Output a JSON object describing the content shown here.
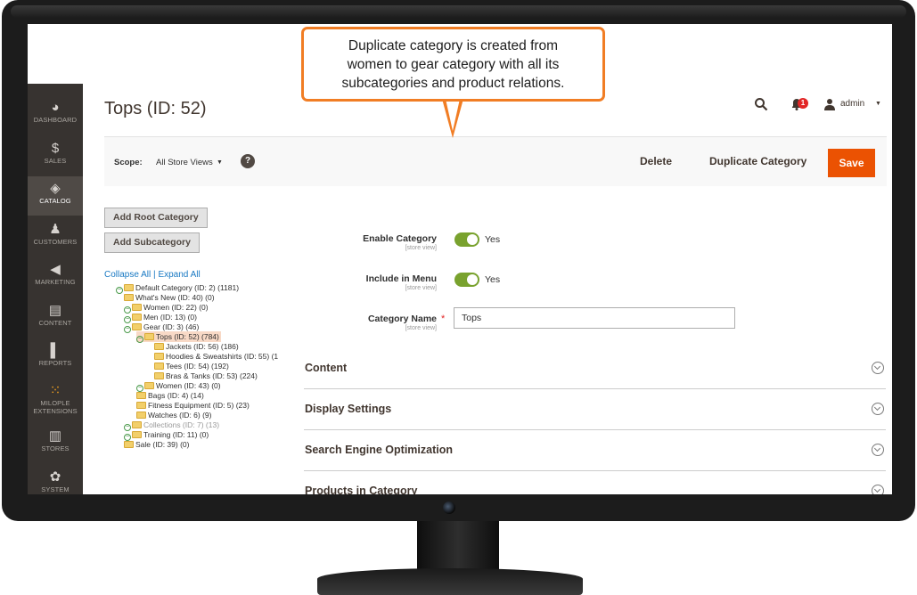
{
  "callout": {
    "lines": [
      "Duplicate category is created from",
      "women to gear category with all its",
      "subcategories and product relations."
    ]
  },
  "sidebar": {
    "items": [
      {
        "label": "DASHBOARD",
        "icon": "dashboard-icon",
        "glyph": "◕"
      },
      {
        "label": "SALES",
        "icon": "dollar-icon",
        "glyph": "$"
      },
      {
        "label": "CATALOG",
        "icon": "cube-icon",
        "glyph": "◈"
      },
      {
        "label": "CUSTOMERS",
        "icon": "person-icon",
        "glyph": "♟"
      },
      {
        "label": "MARKETING",
        "icon": "megaphone-icon",
        "glyph": "◀"
      },
      {
        "label": "CONTENT",
        "icon": "layout-icon",
        "glyph": "▤"
      },
      {
        "label": "REPORTS",
        "icon": "bar-chart-icon",
        "glyph": "▌"
      },
      {
        "label": "MILOPLE EXTENSIONS",
        "label_line1": "MILOPLE",
        "label_line2": "EXTENSIONS",
        "icon": "grid-icon",
        "glyph": "⁙"
      },
      {
        "label": "STORES",
        "icon": "store-icon",
        "glyph": "▥"
      },
      {
        "label": "SYSTEM",
        "icon": "gear-icon",
        "glyph": "✿"
      }
    ],
    "active": "CATALOG"
  },
  "header": {
    "title": "Tops (ID: 52)",
    "notification_count": "1",
    "user": "admin"
  },
  "toolbar": {
    "scope_label": "Scope:",
    "scope_value": "All Store Views",
    "help": "?",
    "delete_label": "Delete",
    "duplicate_label": "Duplicate Category",
    "save_label": "Save"
  },
  "left_panel": {
    "add_root_label": "Add Root Category",
    "add_sub_label": "Add Subcategory",
    "collapse_all": "Collapse All",
    "separator": "|",
    "expand_all": "Expand All"
  },
  "tree": [
    {
      "label": "Default Category (ID: 2) (1181)",
      "depth": 1,
      "expander": true
    },
    {
      "label": "What's New (ID: 40) (0)",
      "depth": 2,
      "expander": false
    },
    {
      "label": "Women (ID: 22) (0)",
      "depth": 2,
      "expander": true
    },
    {
      "label": "Men (ID: 13) (0)",
      "depth": 2,
      "expander": true
    },
    {
      "label": "Gear (ID: 3) (46)",
      "depth": 2,
      "expander": true
    },
    {
      "label": "Tops (ID: 52) (784)",
      "depth": 3,
      "expander": true,
      "selected": true
    },
    {
      "label": "Jackets (ID: 56) (186)",
      "depth": 4,
      "expander": false
    },
    {
      "label": "Hoodies & Sweatshirts (ID: 55) (1",
      "depth": 4,
      "expander": false
    },
    {
      "label": "Tees (ID: 54) (192)",
      "depth": 4,
      "expander": false
    },
    {
      "label": "Bras & Tanks (ID: 53) (224)",
      "depth": 4,
      "expander": false
    },
    {
      "label": "Women (ID: 43) (0)",
      "depth": 3,
      "expander": true
    },
    {
      "label": "Bags (ID: 4) (14)",
      "depth": 3,
      "expander": false
    },
    {
      "label": "Fitness Equipment (ID: 5) (23)",
      "depth": 3,
      "expander": false
    },
    {
      "label": "Watches (ID: 6) (9)",
      "depth": 3,
      "expander": false
    },
    {
      "label": "Collections (ID: 7) (13)",
      "depth": 2,
      "expander": true,
      "muted": true
    },
    {
      "label": "Training (ID: 11) (0)",
      "depth": 2,
      "expander": true
    },
    {
      "label": "Sale (ID: 39) (0)",
      "depth": 2,
      "expander": false
    }
  ],
  "form": {
    "enable_label": "Enable Category",
    "enable_scope": "[store view]",
    "enable_value": "Yes",
    "menu_label": "Include in Menu",
    "menu_scope": "[store view]",
    "menu_value": "Yes",
    "name_label": "Category Name",
    "name_scope": "[store view]",
    "name_value": "Tops",
    "required_mark": "*"
  },
  "sections": [
    "Content",
    "Display Settings",
    "Search Engine Optimization",
    "Products in Category"
  ],
  "colors": {
    "accent": "#eb5202",
    "sidebar": "#373330",
    "toggle_on": "#79a22e",
    "callout_border": "#f17d24",
    "link": "#1979c3"
  }
}
